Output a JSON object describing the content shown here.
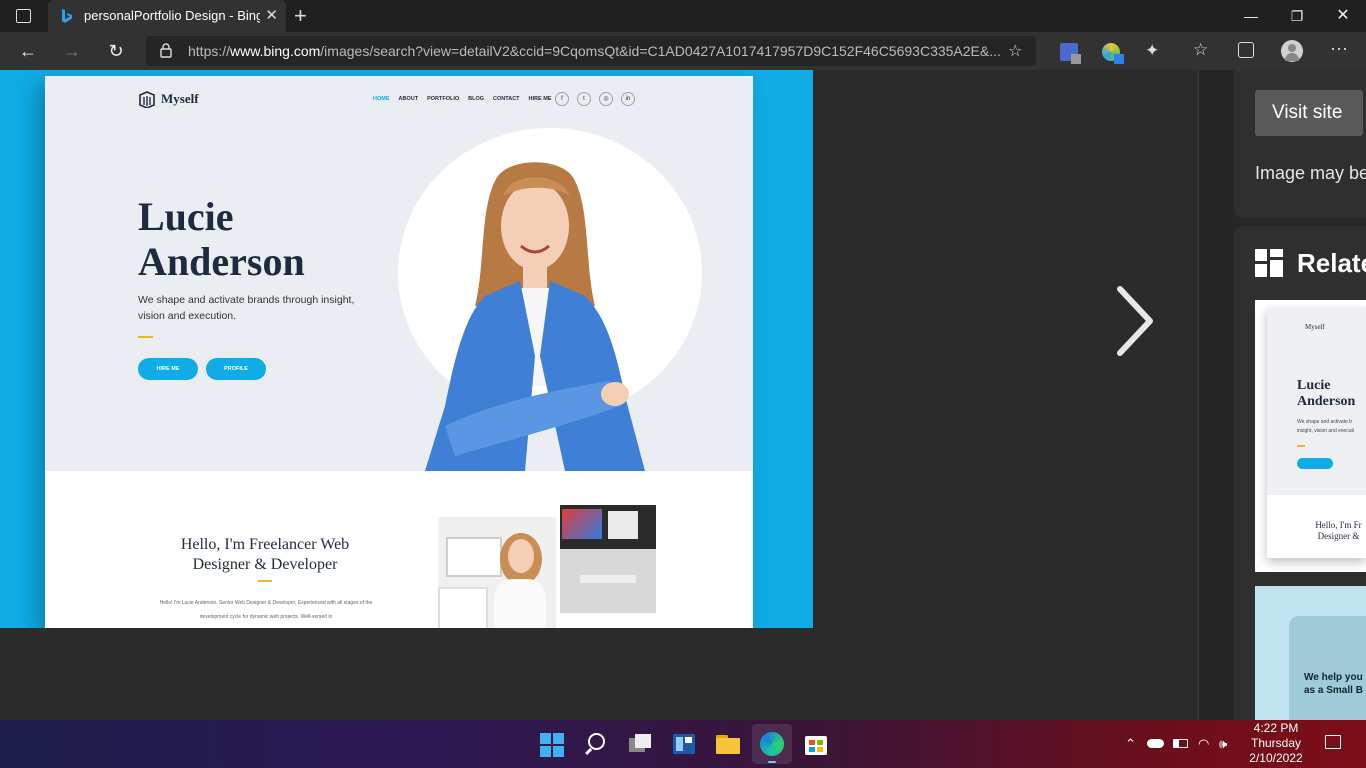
{
  "browser": {
    "tab_title": "personalPortfolio Design - Bing i",
    "url_prefix": "https://",
    "url_domain": "www.bing.com",
    "url_rest": "/images/search?view=detailV2&ccid=9CqomsQt&id=C1AD0427A1017417957D9C152F46C5693C335A2E&..."
  },
  "preview_site": {
    "logo": "Myself",
    "nav": [
      "HOME",
      "ABOUT",
      "PORTFOLIO",
      "BLOG",
      "CONTACT",
      "HIRE ME"
    ],
    "hero_name_line1": "Lucie",
    "hero_name_line2": "Anderson",
    "hero_desc": "We shape and activate brands through insight, vision and execution.",
    "btn_hire": "HIRE ME",
    "btn_profile": "PROFILE",
    "about_title": "Hello, I'm Freelancer Web Designer & Developer",
    "about_text": "Hello! I'm Lucie Anderson, Senior Web Designer & Developer. Experienced with all stages of the development cycle for dynamic web projects. Well-versed in"
  },
  "side_panel": {
    "visit_site": "Visit site",
    "disclaimer": "Image may be",
    "related_title": "Relate",
    "thumb1_logo": "Myself",
    "thumb1_name1": "Lucie",
    "thumb1_name2": "Anderson",
    "thumb1_desc": "We shape and activate b insight, vision and executi",
    "thumb1_about": "Hello, I'm Fr Designer &",
    "thumb2_text1": "We help you",
    "thumb2_text2": "as a Small B"
  },
  "taskbar": {
    "time": "4:22 PM",
    "day": "Thursday",
    "date": "2/10/2022"
  },
  "colors": {
    "accent_blue": "#10ace6",
    "accent_yellow": "#f2b51f",
    "navy": "#1e2a3d"
  }
}
